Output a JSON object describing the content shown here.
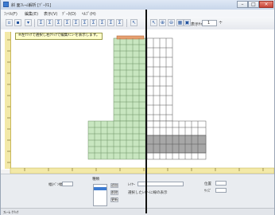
{
  "window": {
    "title": "斜 面ﾌﾚｰﾑ解析 [ﾃﾞｰﾀ1]",
    "min_glyph": "–",
    "max_glyph": "□",
    "close_glyph": "×"
  },
  "menu": {
    "items": [
      "ﾌｧｲﾙ(F)",
      "編集(E)",
      "表示(V)",
      "ﾃﾞｰﾀ(D)",
      "ﾍﾙﾌﾟ(H)"
    ]
  },
  "toolbar": {
    "zoom_label": "表示ｻｲｽﾞ",
    "zoom_value": "1",
    "zoom_spin": "÷",
    "buttons": [
      "new",
      "open",
      "save",
      "frame-1",
      "frame-2",
      "frame-3",
      "frame-4",
      "frame-5",
      "frame-6",
      "frame-7",
      "frame-8",
      "frame-9",
      "frame-10",
      "select",
      "zoom-in",
      "zoom-out",
      "grid",
      "fit"
    ]
  },
  "canvas": {
    "message": "※左ｸﾘｯｸで選択し右ｸﾘｯｸで編集ﾒﾆｭｰを表示します。",
    "colors": {
      "fill_green": "#c8e6c0",
      "fill_gray": "#a7a7a7",
      "top_orange": "#e6a070",
      "ruler": "#f3e9a8"
    }
  },
  "panel": {
    "width_label": "幅(ﾍﾟﾝ幅)",
    "type_label": "種類",
    "layer_label": "ﾚｲﾔｰ",
    "option_label": "選択したﾚｲﾔｰに線の表示",
    "pos_label": "位置",
    "size_label": "ｻｲｽﾞ",
    "btn_labels": [
      "追加",
      "削除",
      "更新"
    ]
  },
  "statusbar": {
    "text": "ﾌﾚｰﾑ ｸﾘｯｸ"
  }
}
